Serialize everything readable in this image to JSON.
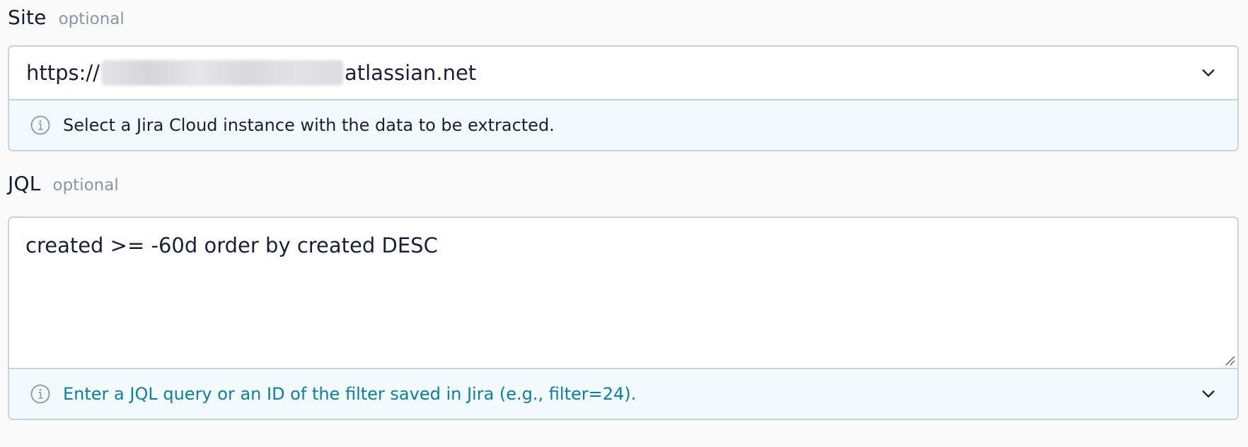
{
  "site": {
    "label": "Site",
    "optional": "optional",
    "value_prefix": "https://",
    "value_suffix": "atlassian.net",
    "hint": "Select a Jira Cloud instance with the data to be extracted."
  },
  "jql": {
    "label": "JQL",
    "optional": "optional",
    "value": "created >= -60d order by created DESC",
    "hint": "Enter a JQL query or an ID of the filter saved in Jira (e.g., filter=24)."
  },
  "icons": {
    "info": "info-icon",
    "chevron": "chevron-down-icon",
    "resize": "resize-handle-icon"
  },
  "colors": {
    "label": "#151a33",
    "optional": "#8a96a3",
    "border": "#c9d3d9",
    "hint_background": "#f2fafd",
    "link": "#0d7fa3"
  }
}
